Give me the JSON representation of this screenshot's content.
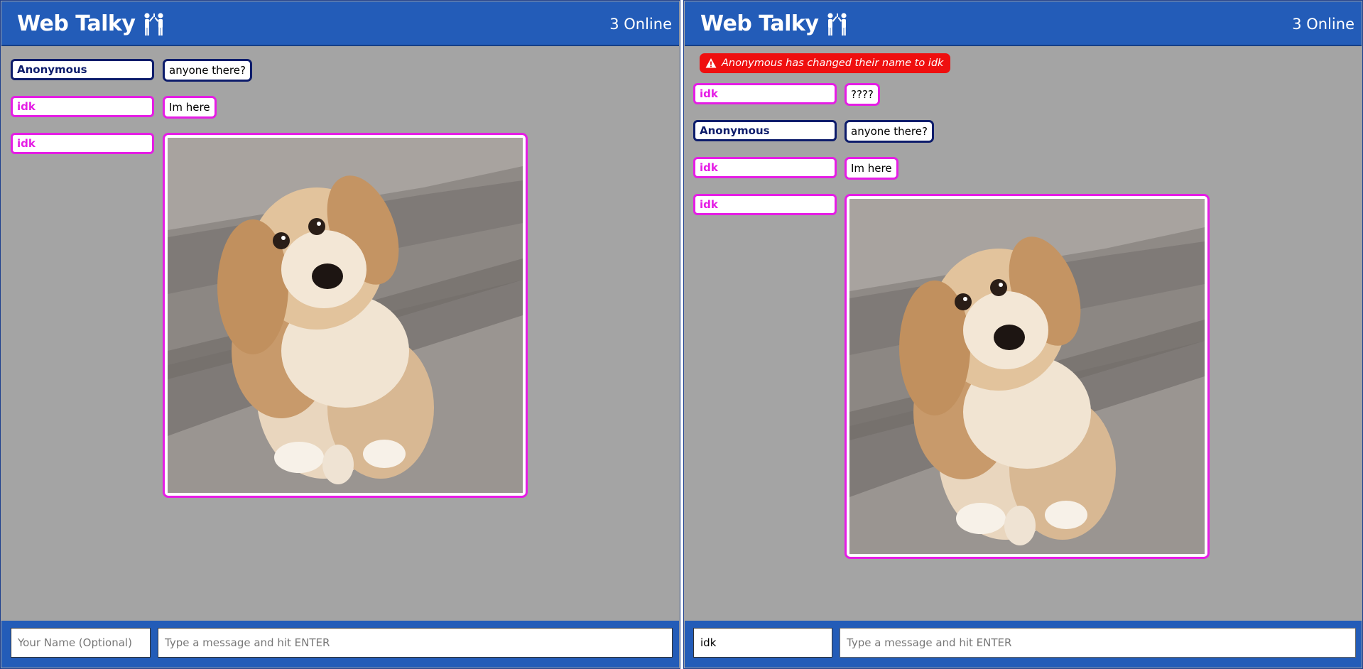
{
  "app": {
    "title": "Web Talky",
    "online_label": "3 Online"
  },
  "colors": {
    "header": "#235cb8",
    "pane_bg": "#a4a4a4",
    "anonymous": "#0d1c6b",
    "idk": "#e51de5",
    "notice": "#ef0f0f"
  },
  "left": {
    "messages": [
      {
        "name": "Anonymous",
        "text": "anyone there?"
      },
      {
        "name": "idk",
        "text": "Im here"
      },
      {
        "name": "idk",
        "image": "puppy-photo"
      }
    ],
    "name_input": {
      "value": "",
      "placeholder": "Your Name (Optional)"
    },
    "message_input": {
      "value": "",
      "placeholder": "Type a message and hit ENTER"
    }
  },
  "right": {
    "notice": {
      "icon": "warning-icon",
      "text": "Anonymous has changed their name to idk"
    },
    "messages": [
      {
        "name": "idk",
        "text": "????"
      },
      {
        "name": "Anonymous",
        "text": "anyone there?"
      },
      {
        "name": "idk",
        "text": "Im here"
      },
      {
        "name": "idk",
        "image": "puppy-photo"
      }
    ],
    "name_input": {
      "value": "idk",
      "placeholder": "Your Name (Optional)"
    },
    "message_input": {
      "value": "",
      "placeholder": "Type a message and hit ENTER"
    }
  }
}
